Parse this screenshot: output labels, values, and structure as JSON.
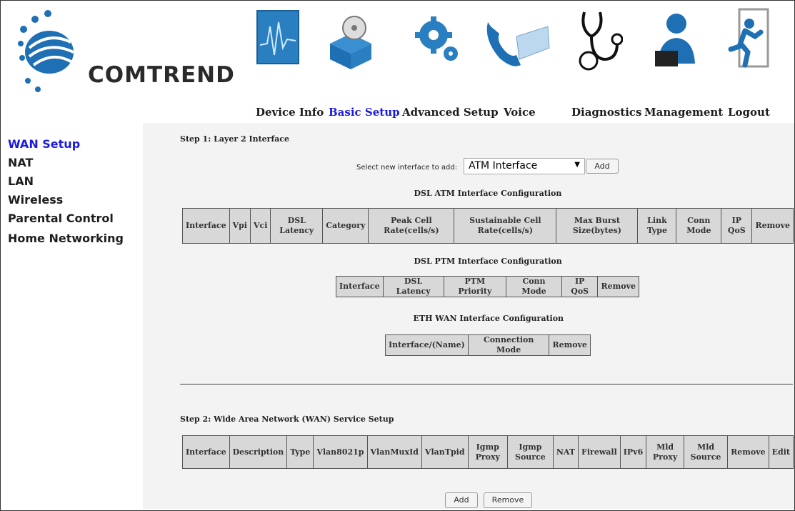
{
  "brand": {
    "name": "COMTREND"
  },
  "nav": {
    "items": [
      {
        "label": "Device Info",
        "icon": "device-info-icon"
      },
      {
        "label": "Basic Setup",
        "icon": "basic-setup-icon",
        "active": true
      },
      {
        "label": "Advanced Setup",
        "icon": "advanced-setup-icon"
      },
      {
        "label": "Voice",
        "icon": "voice-icon"
      },
      {
        "label": "Diagnostics",
        "icon": "diagnostics-icon"
      },
      {
        "label": "Management",
        "icon": "management-icon"
      },
      {
        "label": "Logout",
        "icon": "logout-icon"
      }
    ]
  },
  "sidebar": {
    "items": [
      {
        "label": "WAN Setup",
        "active": true
      },
      {
        "label": "NAT"
      },
      {
        "label": "LAN"
      },
      {
        "label": "Wireless"
      },
      {
        "label": "Parental Control"
      },
      {
        "label": "Home Networking"
      }
    ]
  },
  "step1": {
    "title": "Step 1: Layer 2 Interface",
    "select_label": "Select new interface to add:",
    "select_value": "ATM Interface",
    "add_label": "Add",
    "atm": {
      "title": "DSL ATM Interface Configuration",
      "headers": [
        "Interface",
        "Vpi",
        "Vci",
        "DSL Latency",
        "Category",
        "Peak Cell Rate(cells/s)",
        "Sustainable Cell Rate(cells/s)",
        "Max Burst Size(bytes)",
        "Link Type",
        "Conn Mode",
        "IP QoS",
        "Remove"
      ]
    },
    "ptm": {
      "title": "DSL PTM Interface Configuration",
      "headers": [
        "Interface",
        "DSL Latency",
        "PTM Priority",
        "Conn Mode",
        "IP QoS",
        "Remove"
      ]
    },
    "eth": {
      "title": "ETH WAN Interface Configuration",
      "headers": [
        "Interface/(Name)",
        "Connection Mode",
        "Remove"
      ]
    }
  },
  "step2": {
    "title": "Step 2: Wide Area Network (WAN) Service Setup",
    "headers": [
      "Interface",
      "Description",
      "Type",
      "Vlan8021p",
      "VlanMuxId",
      "VlanTpid",
      "Igmp Proxy",
      "Igmp Source",
      "NAT",
      "Firewall",
      "IPv6",
      "Mld Proxy",
      "Mld Source",
      "Remove",
      "Edit"
    ],
    "add_label": "Add",
    "remove_label": "Remove"
  },
  "colors": {
    "active": "#1a1ae0",
    "panel": "#f3f3f3",
    "header_cell": "#d8d8d8"
  }
}
